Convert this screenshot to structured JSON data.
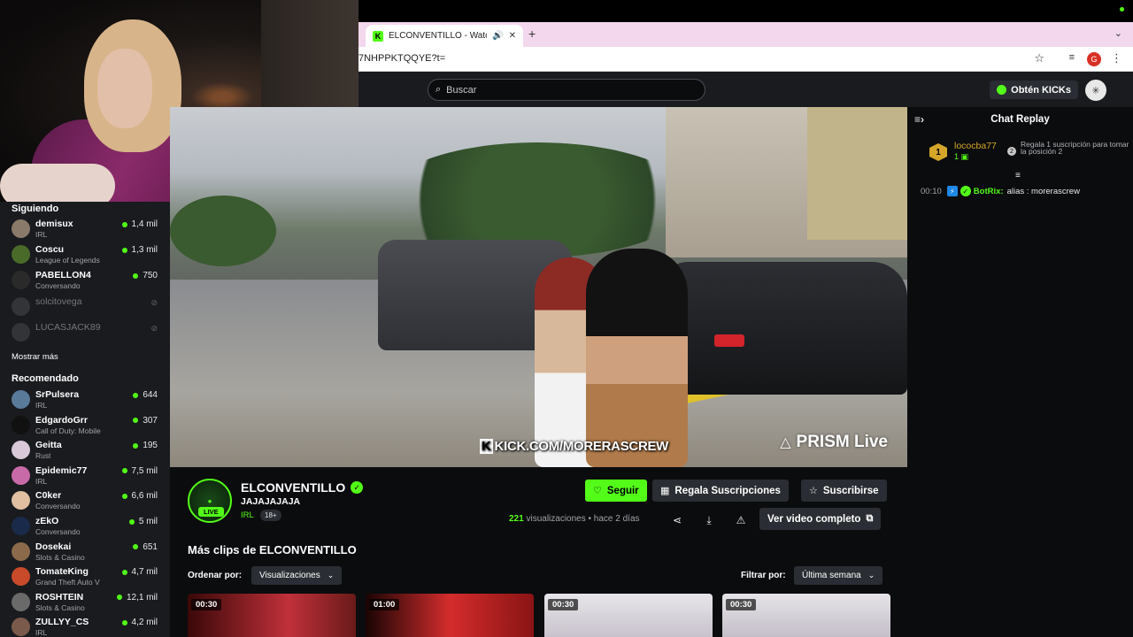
{
  "browser": {
    "tab_title": "ELCONVENTILLO - Watch",
    "tab_favicon": "K",
    "url": "7NHPPKTQQYE?t=",
    "profile_initial": "G"
  },
  "header": {
    "search_placeholder": "Buscar",
    "kicks_label": "Obtén KICKs"
  },
  "sidebar": {
    "following_title": "Siguiendo",
    "following": [
      {
        "name": "demisux",
        "category": "IRL",
        "viewers": "1,4 mil",
        "avatar_color": "#8a7a6a"
      },
      {
        "name": "Coscu",
        "category": "League of Legends",
        "viewers": "1,3 mil",
        "avatar_color": "#4a6a2a"
      },
      {
        "name": "PABELLON4",
        "category": "Conversando",
        "viewers": "750",
        "avatar_color": "#2a2a2a"
      }
    ],
    "offline": [
      {
        "name": "solcitovega"
      },
      {
        "name": "LUCASJACK89"
      }
    ],
    "show_more": "Mostrar más",
    "recommended_title": "Recomendado",
    "recommended": [
      {
        "name": "SrPulsera",
        "category": "IRL",
        "viewers": "644",
        "avatar_color": "#5a7a9a"
      },
      {
        "name": "EdgardoGrr",
        "category": "Call of Duty: Mobile",
        "viewers": "307",
        "avatar_color": "#111111"
      },
      {
        "name": "Geitta",
        "category": "Rust",
        "viewers": "195",
        "avatar_color": "#d8c8d8"
      },
      {
        "name": "Epidemic77",
        "category": "IRL",
        "viewers": "7,5 mil",
        "avatar_color": "#c86aa8"
      },
      {
        "name": "C0ker",
        "category": "Conversando",
        "viewers": "6,6 mil",
        "avatar_color": "#e0c0a0"
      },
      {
        "name": "zEkO",
        "category": "Conversando",
        "viewers": "5 mil",
        "avatar_color": "#1a2a4a"
      },
      {
        "name": "Dosekai",
        "category": "Slots & Casino",
        "viewers": "651",
        "avatar_color": "#8a6a4a"
      },
      {
        "name": "TomateKing",
        "category": "Grand Theft Auto V",
        "viewers": "4,7 mil",
        "avatar_color": "#c84a2a"
      },
      {
        "name": "ROSHTEIN",
        "category": "Slots & Casino",
        "viewers": "12,1 mil",
        "avatar_color": "#6a6a6a"
      },
      {
        "name": "ZULLYY_CS",
        "category": "IRL",
        "viewers": "4,2 mil",
        "avatar_color": "#7a5a4a"
      }
    ]
  },
  "video": {
    "watermark_kick": "KICK.COM/MORERASCREW",
    "watermark_prism": "PRISM Live"
  },
  "channel": {
    "name": "ELCONVENTILLO",
    "clip_title": "JAJAJAJAJA",
    "category": "IRL",
    "age_badge": "18+",
    "live_badge": "LIVE",
    "follow_label": "Seguir",
    "gift_label": "Regala Suscripciones",
    "subscribe_label": "Suscribirse",
    "view_count": "221",
    "views_suffix": "visualizaciones",
    "time_ago": "hace 2 días",
    "full_video_label": "Ver video completo"
  },
  "clips_section": {
    "title": "Más clips de ELCONVENTILLO",
    "sort_label": "Ordenar por:",
    "sort_value": "Visualizaciones",
    "filter_label": "Filtrar por:",
    "filter_value": "Última semana",
    "durations": [
      "00:30",
      "01:00",
      "00:30",
      "00:30"
    ]
  },
  "chat": {
    "title": "Chat Replay",
    "pinned": {
      "rank": "1",
      "user": "lococba77",
      "count": "1",
      "message": "Regala 1 suscripción para tomar la posición 2"
    },
    "messages": [
      {
        "time": "00:10",
        "user": "BotRix",
        "text": "alias : morerascrew"
      }
    ]
  },
  "colors": {
    "brand_green": "#53fc18",
    "surface": "#191b1f",
    "background": "#0b0c0e",
    "gold": "#d4a62a"
  }
}
